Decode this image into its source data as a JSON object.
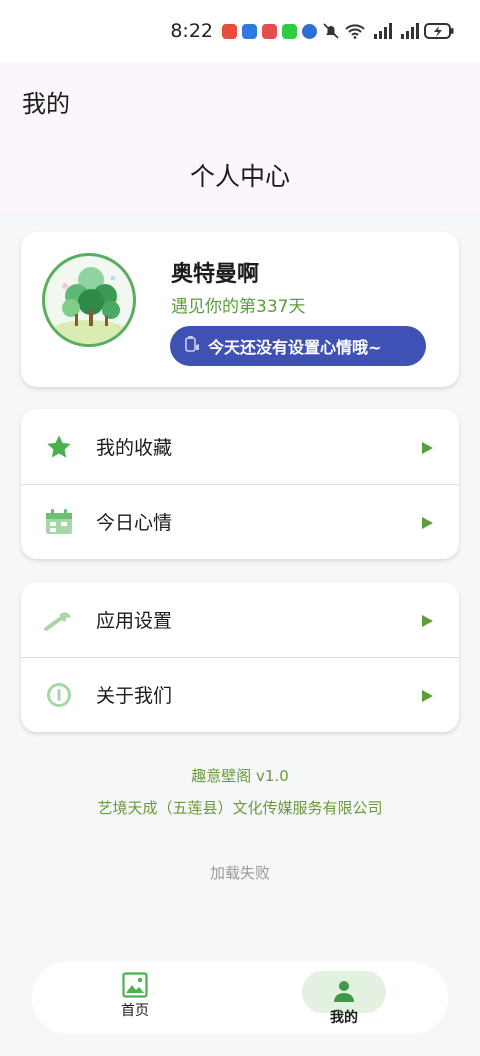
{
  "status": {
    "time": "8:22"
  },
  "appbar": {
    "title": "我的",
    "subtitle": "个人中心"
  },
  "profile": {
    "username": "奥特曼啊",
    "days_text": "遇见你的第337天",
    "mood_button": "今天还没有设置心情哦~"
  },
  "menu1": [
    {
      "label": "我的收藏",
      "icon": "star-icon"
    },
    {
      "label": "今日心情",
      "icon": "calendar-icon"
    }
  ],
  "menu2": [
    {
      "label": "应用设置",
      "icon": "wrench-icon"
    },
    {
      "label": "关于我们",
      "icon": "info-icon"
    }
  ],
  "footer": {
    "version": "趣意壁阁 v1.0",
    "company": "艺境天成（五莲县）文化传媒服务有限公司",
    "load_status": "加载失败"
  },
  "nav": {
    "home": "首页",
    "mine": "我的"
  },
  "colors": {
    "accent_green": "#4caf50",
    "mood_button": "#3f51b5",
    "text_green": "#5a9e3a"
  }
}
